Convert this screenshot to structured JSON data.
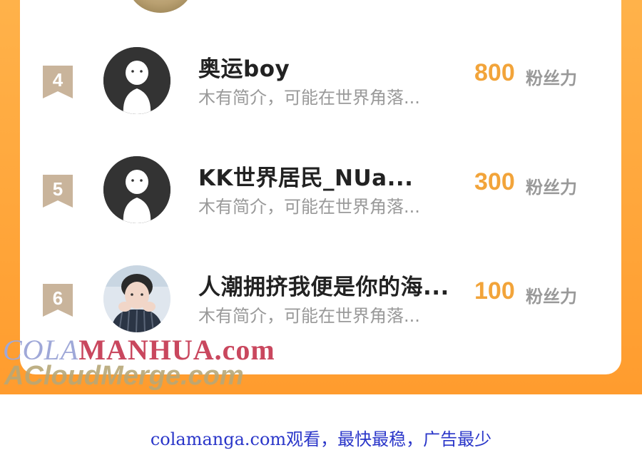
{
  "leaderboard": {
    "unit_label": "粉丝力",
    "entries": [
      {
        "rank": "4",
        "name": "奥运boy",
        "bio": "木有简介，可能在世界角落...",
        "score": "800",
        "avatar": "default-avatar"
      },
      {
        "rank": "5",
        "name": "KK世界居民_NUa...",
        "bio": "木有简介，可能在世界角落...",
        "score": "300",
        "avatar": "default-avatar"
      },
      {
        "rank": "6",
        "name": "人潮拥挤我便是你的海...",
        "bio": "木有简介，可能在世界角落...",
        "score": "100",
        "avatar": "photo-avatar"
      }
    ]
  },
  "watermarks": {
    "colamanhua_part1": "COLA",
    "colamanhua_part2": "MANHUA.com",
    "acloudmerge": "ACloudMerge.com"
  },
  "footer": {
    "text": "colamanga.com观看，最快最稳，广告最少"
  },
  "colors": {
    "frame": "#ff9c2e",
    "score": "#f2a43a",
    "rank_badge": "#c9b49b",
    "footer_link": "#2a36c9"
  }
}
